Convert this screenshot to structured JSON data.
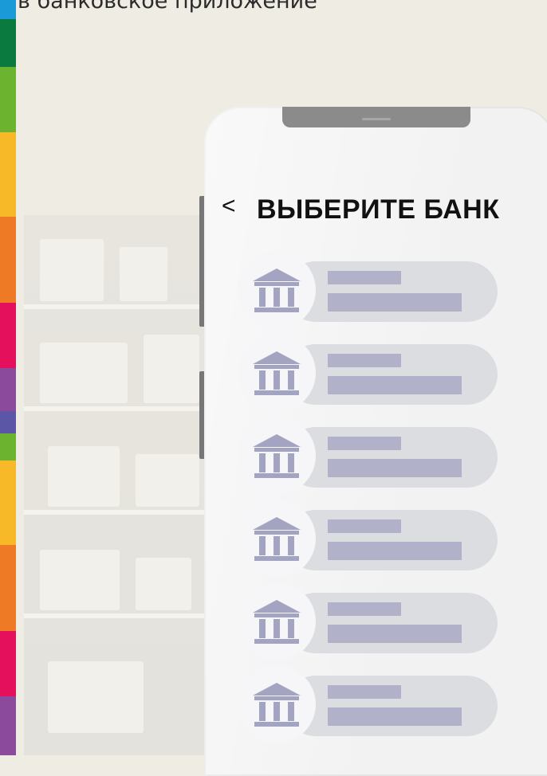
{
  "header_text": "в банковское приложение",
  "screen": {
    "back_label": "<",
    "title": "ВЫБЕРИТЕ БАНК"
  },
  "banks": [
    {
      "icon": "bank-icon"
    },
    {
      "icon": "bank-icon"
    },
    {
      "icon": "bank-icon"
    },
    {
      "icon": "bank-icon"
    },
    {
      "icon": "bank-icon"
    },
    {
      "icon": "bank-icon"
    }
  ],
  "colors": {
    "strip": [
      "#1a9ad6",
      "#0b7a3e",
      "#6cb42f",
      "#f7b928",
      "#ef7a26",
      "#e5105c",
      "#8c4a9c",
      "#5b56a6",
      "#6cb42f",
      "#f7b928",
      "#ef7a26",
      "#e5105c",
      "#8c4a9c"
    ],
    "icon": "#a3a3c2",
    "placeholder": "#b1b1c9",
    "pill": "#dcdde1"
  }
}
